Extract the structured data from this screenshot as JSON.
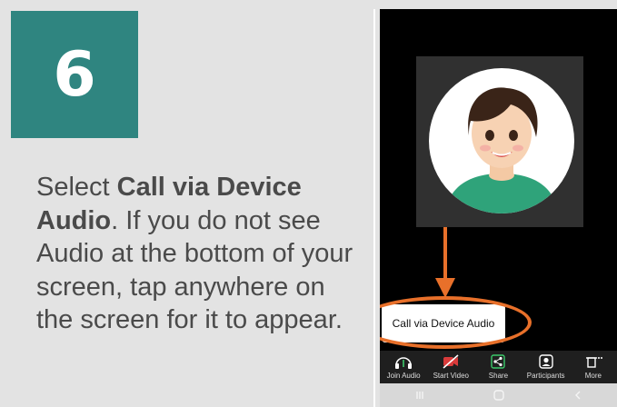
{
  "step": {
    "number": "6"
  },
  "instructions": {
    "t1": "Select ",
    "b1": "Call via Device Audio",
    "t2": ". If you do not see Audio at the bottom of your screen, tap anywhere on the screen for it to appear."
  },
  "phone": {
    "popup_label": "Call via Device Audio",
    "toolbar": [
      {
        "label": "Join Audio",
        "icon": "headphones-icon"
      },
      {
        "label": "Start Video",
        "icon": "video-off-icon"
      },
      {
        "label": "Share",
        "icon": "share-icon"
      },
      {
        "label": "Participants",
        "icon": "participants-icon"
      },
      {
        "label": "More",
        "icon": "more-icon"
      }
    ]
  },
  "colors": {
    "step_box": "#2f8580",
    "accent_orange": "#e8702a",
    "background": "#e3e3e3",
    "text": "#4a4a4a"
  }
}
